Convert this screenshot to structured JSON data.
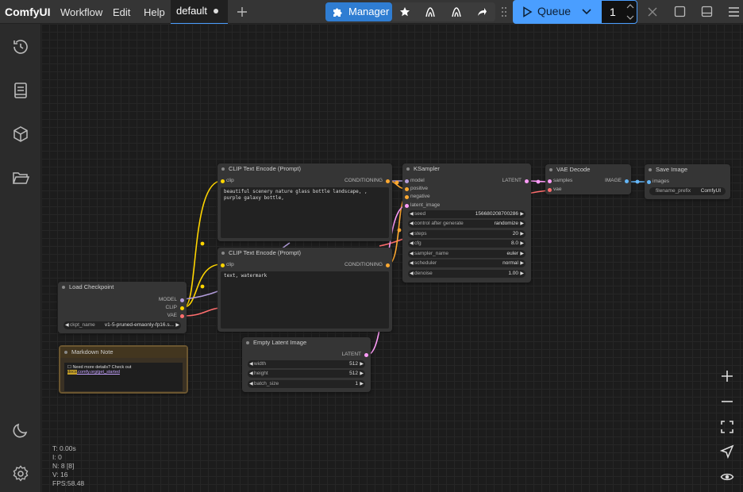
{
  "app": {
    "logo": "ComfyUI"
  },
  "menu": [
    "Workflow",
    "Edit",
    "Help"
  ],
  "tab": {
    "label": "default"
  },
  "toolbar": {
    "manager_label": "Manager",
    "queue_label": "Queue",
    "batch_count": "1"
  },
  "sidebar": {
    "items": [
      "history-icon",
      "model-library-icon",
      "node-library-icon",
      "workflows-icon"
    ],
    "bottom": [
      "theme-toggle-icon",
      "settings-icon"
    ]
  },
  "colors": {
    "accent": "#2f7dd2",
    "queue": "#4a9eff",
    "clip": "#ffd500",
    "model": "#b39ddb",
    "vae": "#ff6e6e",
    "latent": "#ff9cf9",
    "conditioning": "#ffa931",
    "image": "#64b5f6"
  },
  "nodes": {
    "clip1": {
      "title": "CLIP Text Encode (Prompt)",
      "in_clip": "clip",
      "out": "CONDITIONING",
      "text": "beautiful scenery nature glass bottle landscape, , purple galaxy bottle,"
    },
    "clip2": {
      "title": "CLIP Text Encode (Prompt)",
      "in_clip": "clip",
      "out": "CONDITIONING",
      "text": "text, watermark"
    },
    "ksampler": {
      "title": "KSampler",
      "inputs": [
        "model",
        "positive",
        "negative",
        "latent_image"
      ],
      "out": "LATENT",
      "widgets": [
        {
          "label": "seed",
          "value": "156680208700286"
        },
        {
          "label": "control after generate",
          "value": "randomize"
        },
        {
          "label": "steps",
          "value": "20"
        },
        {
          "label": "cfg",
          "value": "8.0"
        },
        {
          "label": "sampler_name",
          "value": "euler"
        },
        {
          "label": "scheduler",
          "value": "normal"
        },
        {
          "label": "denoise",
          "value": "1.00"
        }
      ]
    },
    "vaedecode": {
      "title": "VAE Decode",
      "in_samples": "samples",
      "in_vae": "vae",
      "out": "IMAGE"
    },
    "save": {
      "title": "Save Image",
      "in_images": "images",
      "prefix_label": "filename_prefix",
      "prefix_value": "ComfyUI"
    },
    "checkpoint": {
      "title": "Load Checkpoint",
      "out_model": "MODEL",
      "out_clip": "CLIP",
      "out_vae": "VAE",
      "ckpt_label": "ckpt_name",
      "ckpt_value": "v1-5-pruned-emaonly-fp16.s..."
    },
    "note": {
      "title": "Markdown Note",
      "text_prefix": "☐ Need more details? Check out ",
      "link_hl": "docs",
      "link_rest": ".comfy.org/get_started"
    },
    "latent": {
      "title": "Empty Latent Image",
      "out": "LATENT",
      "widgets": [
        {
          "label": "width",
          "value": "512"
        },
        {
          "label": "height",
          "value": "512"
        },
        {
          "label": "batch_size",
          "value": "1"
        }
      ]
    }
  },
  "stats": {
    "t": "T: 0.00s",
    "i": "I: 0",
    "n": "N: 8 [8]",
    "v": "V: 16",
    "fps": "FPS:58.48"
  },
  "zoom_controls": [
    "zoom-in-icon",
    "zoom-out-icon",
    "fit-view-icon",
    "locate-icon",
    "toggle-links-icon"
  ]
}
